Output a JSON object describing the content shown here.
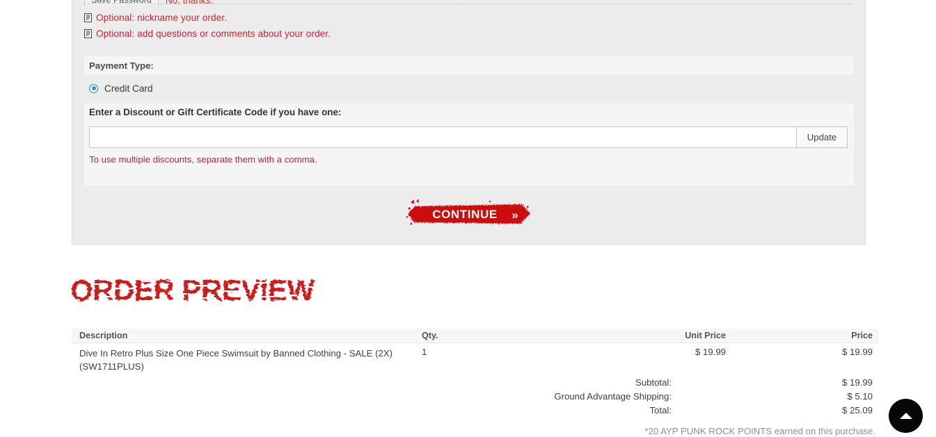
{
  "password_prompt": {
    "save_button_label": "Save Password",
    "dismiss_label": "No, thanks."
  },
  "optional_links": [
    {
      "label": "Optional: nickname your order.",
      "icon": "document-icon"
    },
    {
      "label": "Optional: add questions or comments about your order.",
      "icon": "document-icon"
    }
  ],
  "payment": {
    "header_label": "Payment Type:",
    "options": [
      {
        "label": "Credit Card",
        "selected": true
      }
    ]
  },
  "discount": {
    "title": "Enter a Discount or Gift Certificate Code if you have one:",
    "input_value": "",
    "input_placeholder": "",
    "update_label": "Update",
    "note": "To use multiple discounts, separate them with a comma."
  },
  "continue_button": {
    "label": "CONTINUE",
    "chevron": "»",
    "color": "#cc1111"
  },
  "order_preview": {
    "heading": "ORDER PREVIEW",
    "heading_color": "#cc1a1a",
    "columns": [
      "Description",
      "Qty.",
      "Unit Price",
      "Price"
    ],
    "rows": [
      {
        "description": "Dive In Retro Plus Size One Piece Swimsuit by Banned Clothing - SALE (2X) (SW1711PLUS)",
        "qty": "1",
        "unit_price": "$ 19.99",
        "price": "$ 19.99"
      }
    ],
    "totals": [
      {
        "label": "Subtotal:",
        "value": "$ 19.99"
      },
      {
        "label": "Ground Advantage Shipping:",
        "value": "$  5.10"
      },
      {
        "label": "Total:",
        "value": "$ 25.09"
      }
    ],
    "points_note": "*20 AYP PUNK ROCK POINTS earned on this purchase."
  },
  "scroll_top": {
    "icon": "caret-up-icon"
  }
}
